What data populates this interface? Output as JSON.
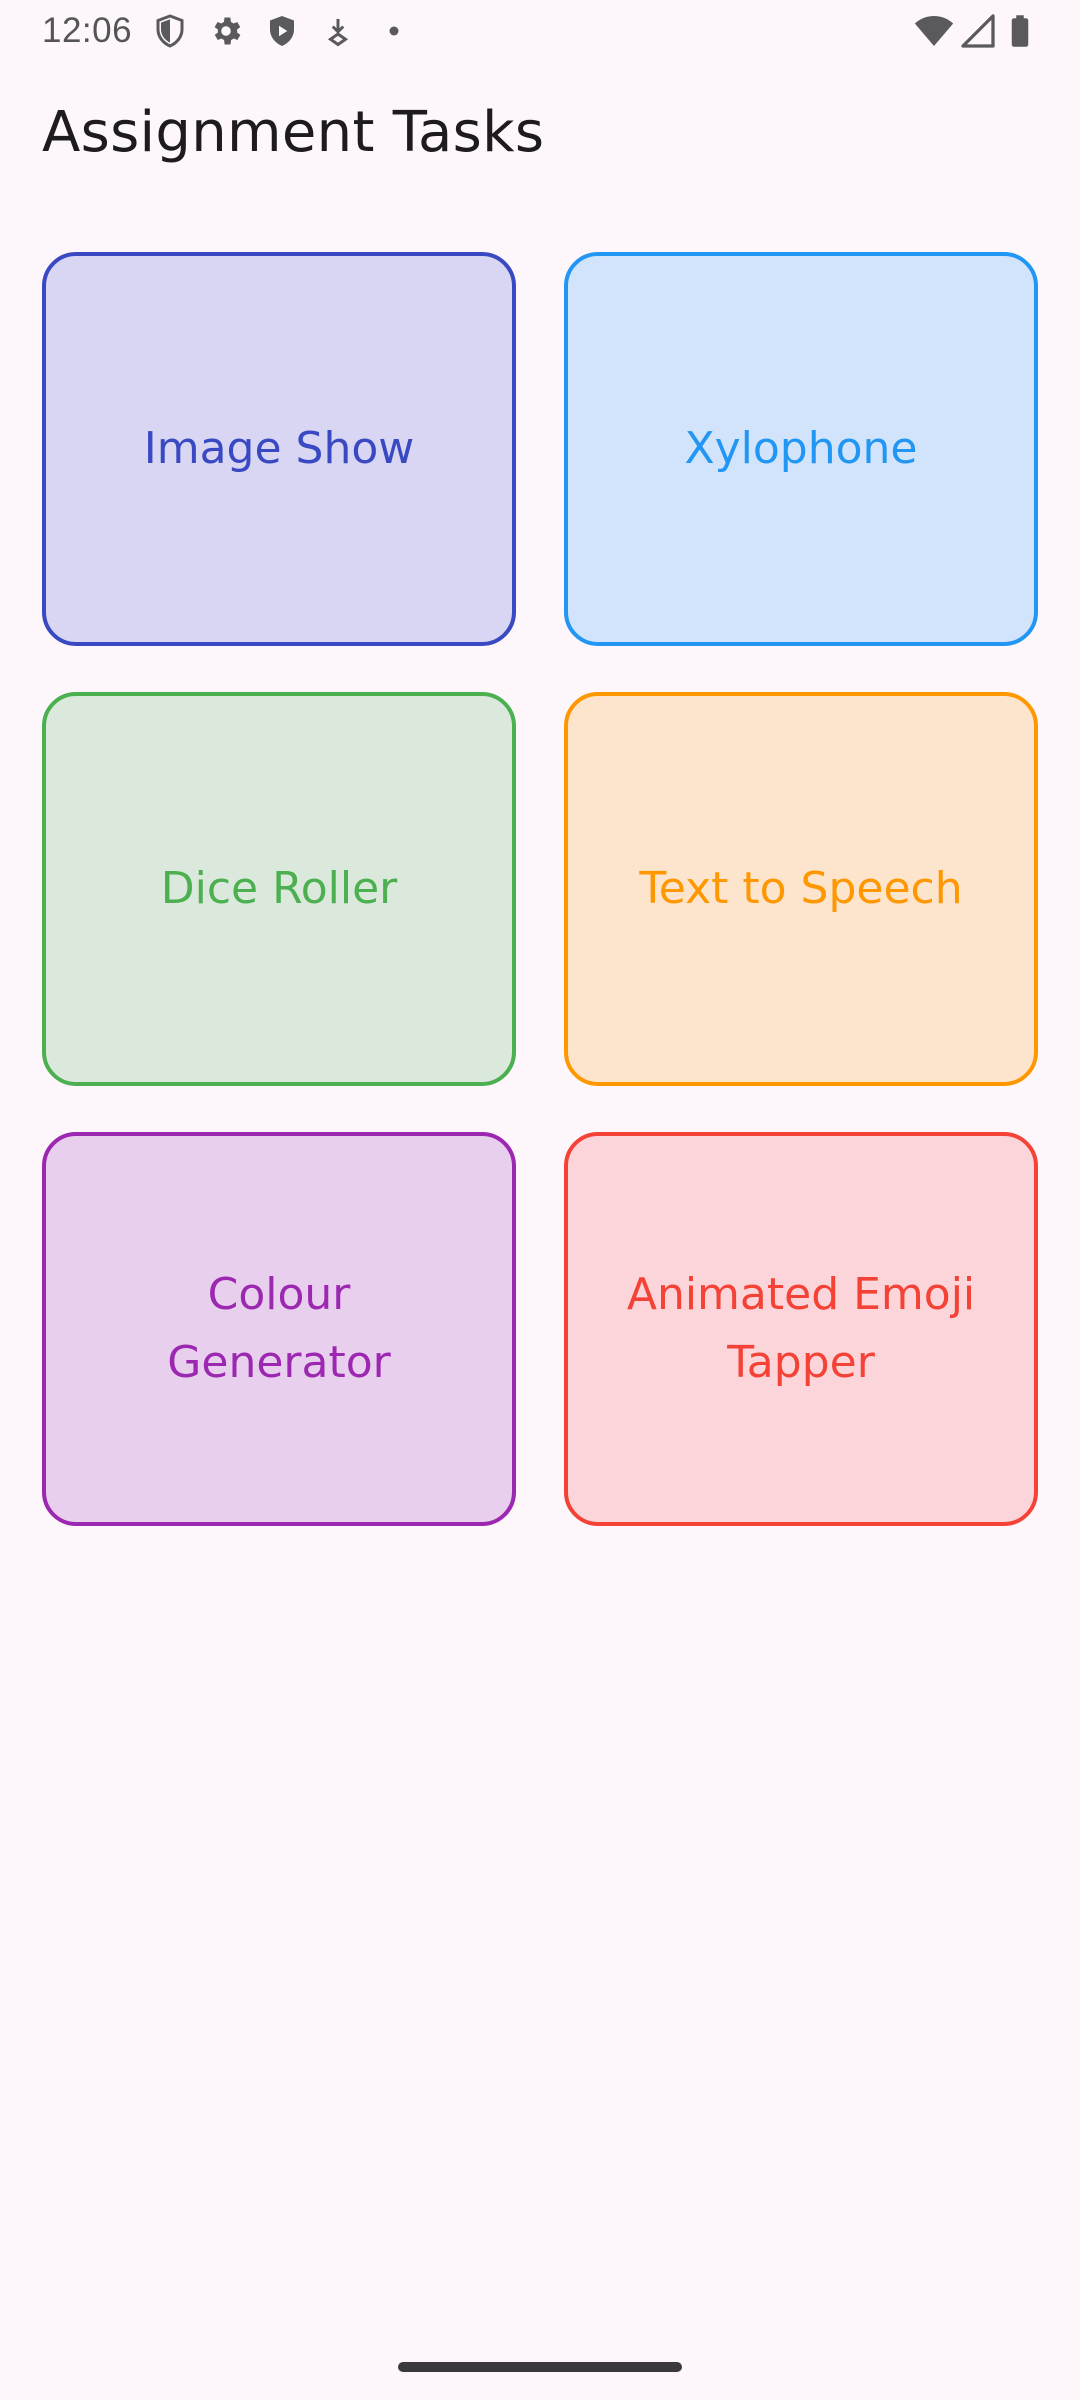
{
  "status_bar": {
    "time": "12:06",
    "left_icons": [
      "shield-outline-icon",
      "gear-icon",
      "shield-play-icon",
      "download-arrow-icon",
      "dot-icon"
    ],
    "right_icons": [
      "wifi-icon",
      "cellular-signal-icon",
      "battery-icon"
    ]
  },
  "app_bar": {
    "title": "Assignment Tasks"
  },
  "tiles": [
    {
      "label": "Image Show",
      "color": "#3949c2",
      "background": "#d8d6f3"
    },
    {
      "label": "Xylophone",
      "color": "#2196f3",
      "background": "#d2e4fb"
    },
    {
      "label": "Dice Roller",
      "color": "#4caf50",
      "background": "#dbe9dd"
    },
    {
      "label": "Text to Speech",
      "color": "#ff9800",
      "background": "#fde4cd"
    },
    {
      "label": "Colour Generator",
      "color": "#9c27b0",
      "background": "#e8cfee"
    },
    {
      "label": "Animated Emoji Tapper",
      "color": "#f44336",
      "background": "#fbd5da"
    }
  ]
}
